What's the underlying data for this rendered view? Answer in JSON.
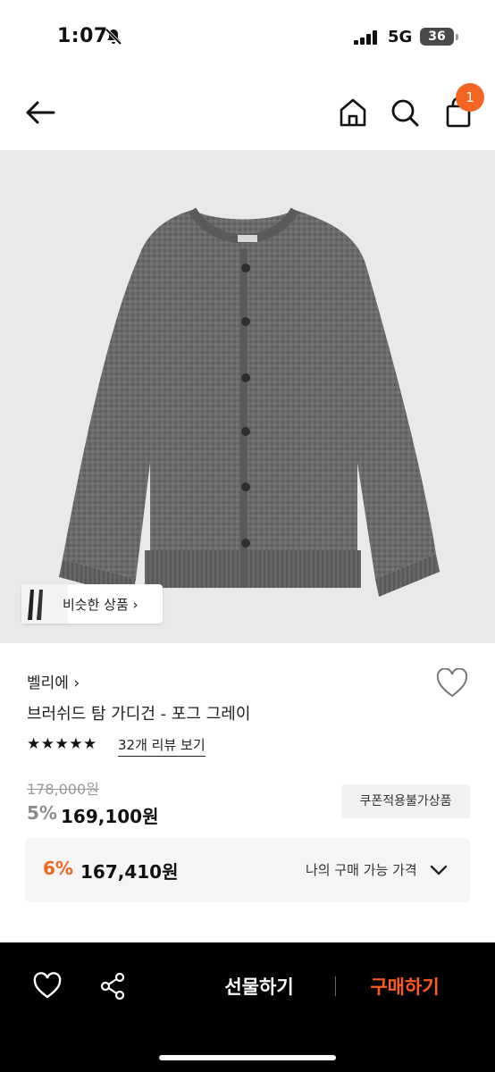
{
  "status": {
    "time": "1:07",
    "network": "5G",
    "battery": "36"
  },
  "header": {
    "cart_count": "1"
  },
  "product": {
    "similar_label": "비슷한 상품",
    "brand": "벨리에",
    "name": "브러쉬드 탐 가디건 - 포그 그레이",
    "stars": "★★★★★",
    "rating": 5,
    "review_link": "32개 리뷰 보기",
    "original_price": "178,000원",
    "discount_rate": "5%",
    "sale_price": "169,100원",
    "coupon_badge": "쿠폰적용불가상품"
  },
  "my_price": {
    "rate": "6%",
    "price": "167,410원",
    "label": "나의 구매 가능 가격"
  },
  "bottom_bar": {
    "gift_label": "선물하기",
    "buy_label": "구매하기"
  },
  "colors": {
    "accent": "#f26522",
    "buy": "#ff5a1f",
    "product_bg": "#e9e9e9"
  }
}
